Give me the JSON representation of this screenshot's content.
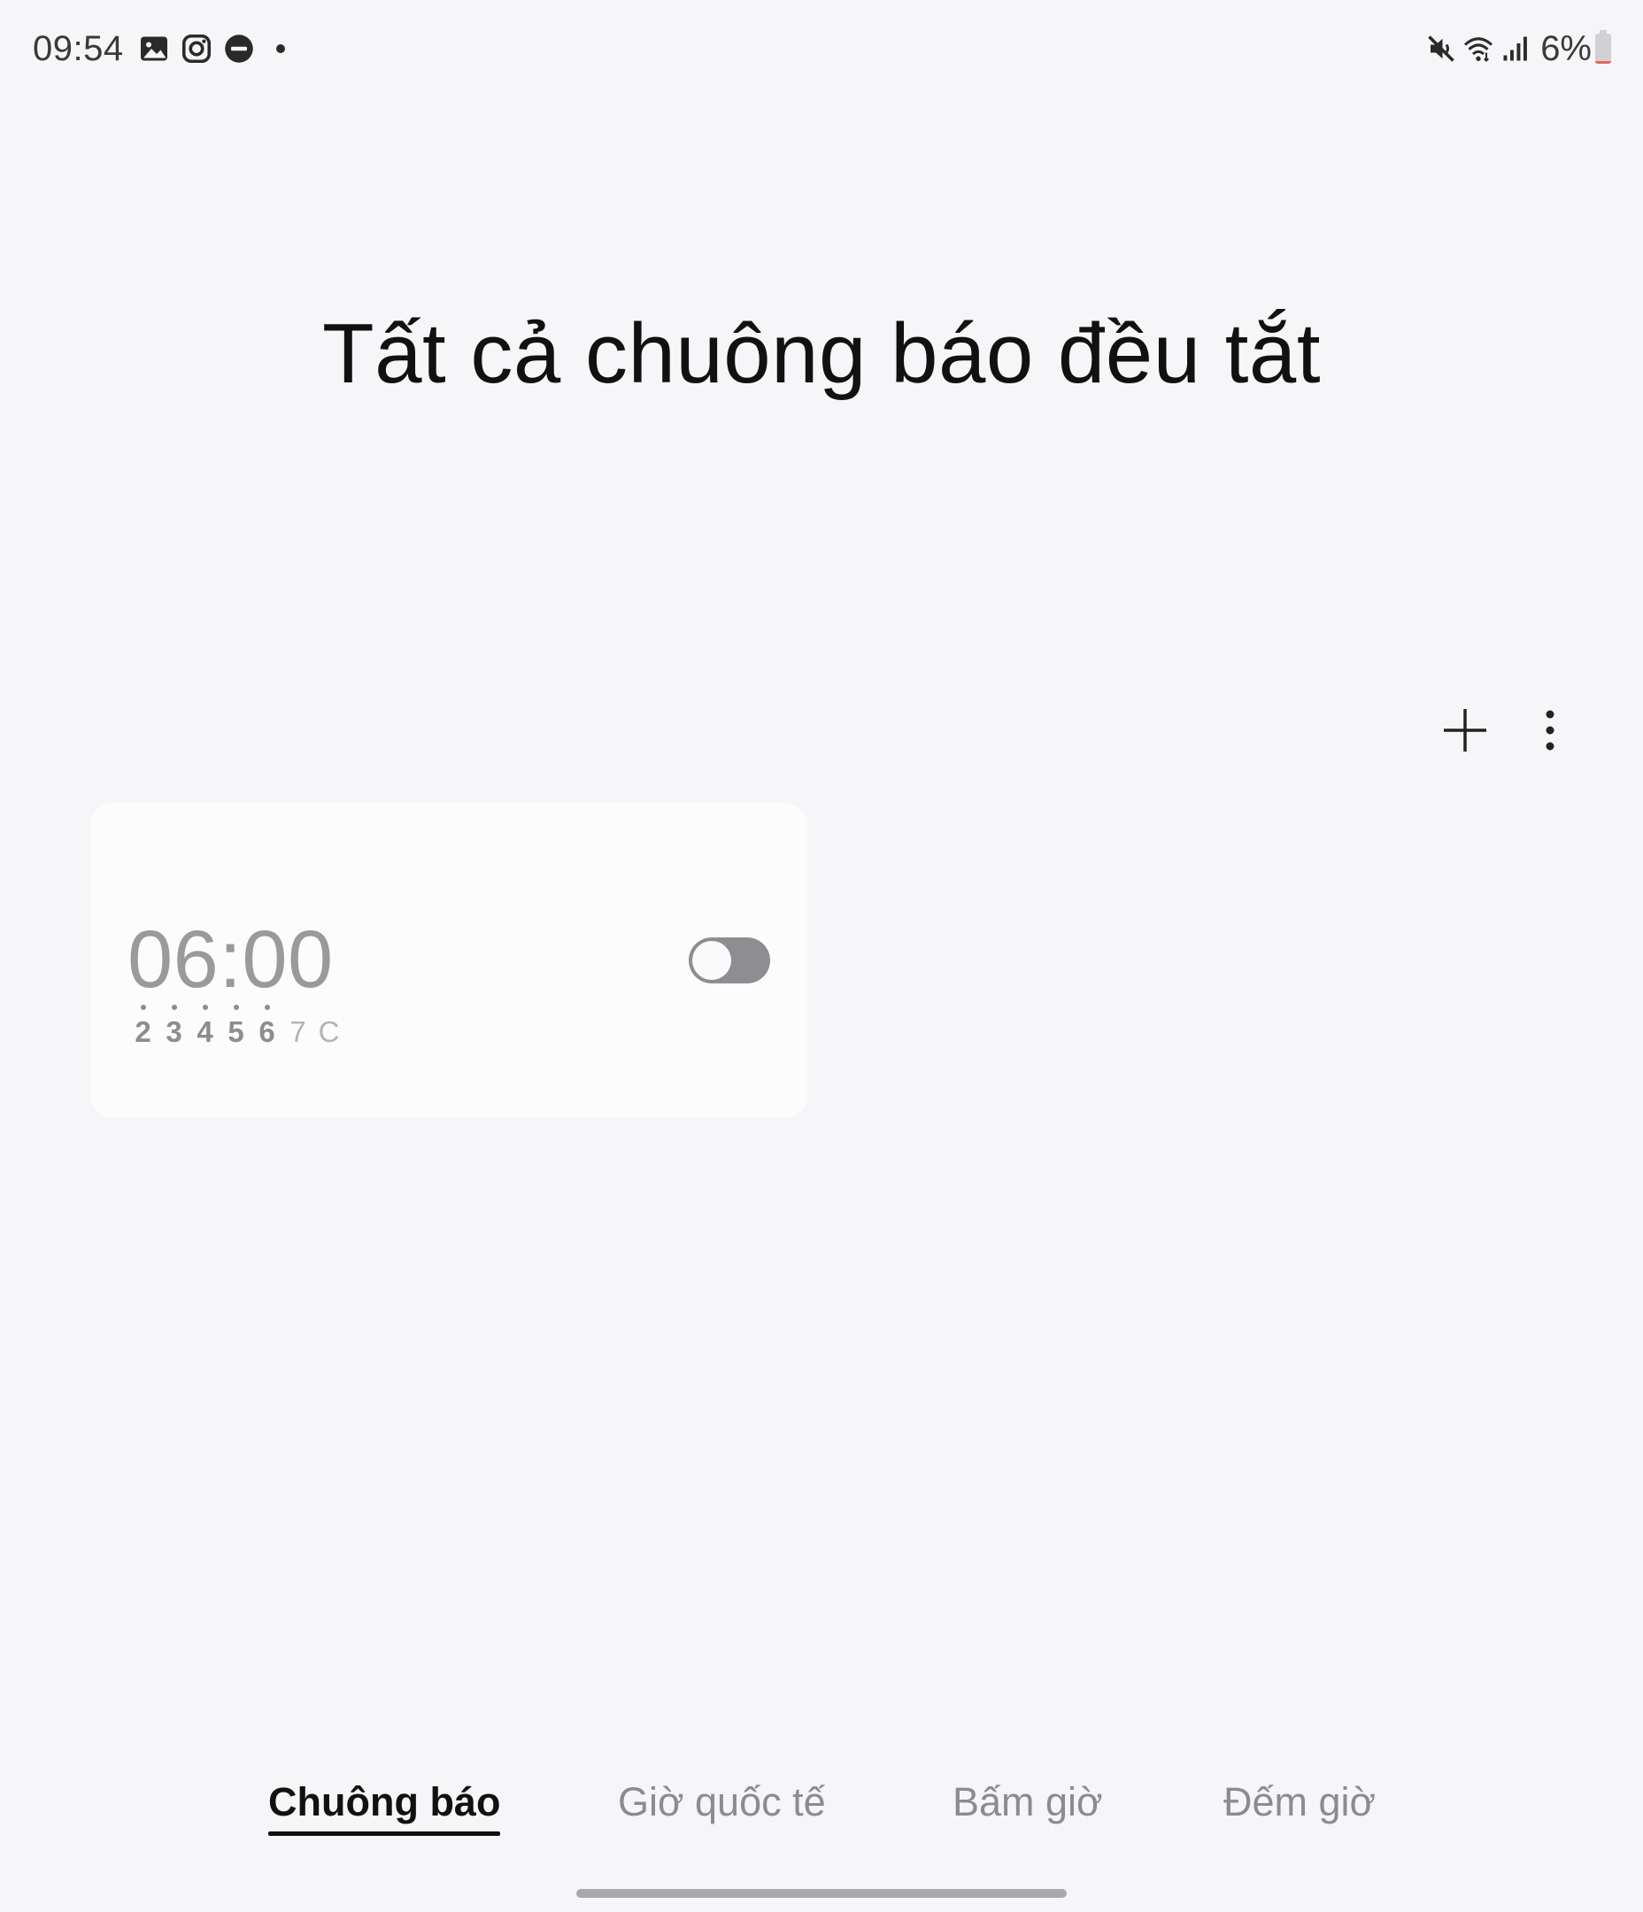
{
  "status_bar": {
    "time": "09:54",
    "left_icons": [
      "gallery-icon",
      "instagram-icon",
      "do-not-disturb-icon",
      "notification-dot"
    ],
    "right_icons": [
      "mute-icon",
      "wifi-icon",
      "signal-icon"
    ],
    "battery_text": "6%",
    "battery_level": 0.06
  },
  "header": {
    "title": "Tất cả chuông báo đều tắt"
  },
  "toolbar": {
    "add_icon": "plus-icon",
    "more_icon": "more-vertical-icon"
  },
  "alarm": {
    "time": "06:00",
    "enabled": false,
    "days": [
      {
        "label": "2",
        "selected": true
      },
      {
        "label": "3",
        "selected": true
      },
      {
        "label": "4",
        "selected": true
      },
      {
        "label": "5",
        "selected": true
      },
      {
        "label": "6",
        "selected": true
      },
      {
        "label": "7",
        "selected": false
      },
      {
        "label": "C",
        "selected": false
      }
    ]
  },
  "tabs": [
    {
      "label": "Chuông báo",
      "active": true
    },
    {
      "label": "Giờ quốc tế",
      "active": false
    },
    {
      "label": "Bấm giờ",
      "active": false
    },
    {
      "label": "Đếm giờ",
      "active": false
    }
  ],
  "colors": {
    "background": "#f6f6f8",
    "card": "#fcfcfd",
    "toggle_off": "#8e8e92",
    "battery_low": "#e2685a"
  }
}
